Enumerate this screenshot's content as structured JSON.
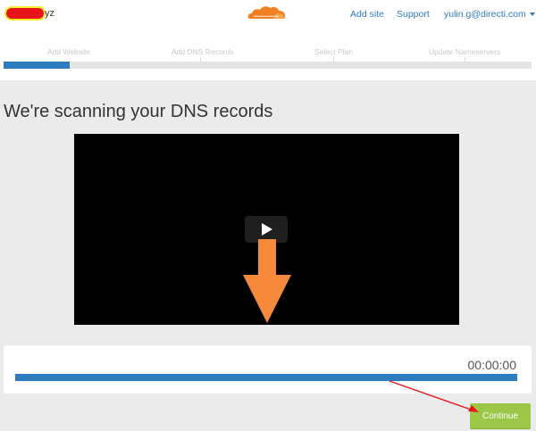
{
  "header": {
    "site_name_suffix": "yz",
    "nav": {
      "add_site": "Add site",
      "support": "Support",
      "user_email": "yulin.g@directi.com"
    }
  },
  "steps": {
    "items": [
      "Add Website",
      "Add DNS Records",
      "Select Plan",
      "Update Nameservers"
    ],
    "active_index": 0,
    "progress_fraction": 0.125
  },
  "main": {
    "heading": "We're scanning your DNS records",
    "time": "00:00:00",
    "scan_progress_fraction": 1.0,
    "continue_label": "Continue"
  },
  "colors": {
    "accent_blue": "#2f7bbf",
    "continue_green": "#9bc847",
    "annotation_orange": "#f6893a",
    "annotation_red": "#e8141b",
    "cloudflare_orange": "#f38020"
  },
  "icons": {
    "logo": "cloudflare-logo",
    "play": "play-icon",
    "caret": "chevron-down-icon"
  }
}
